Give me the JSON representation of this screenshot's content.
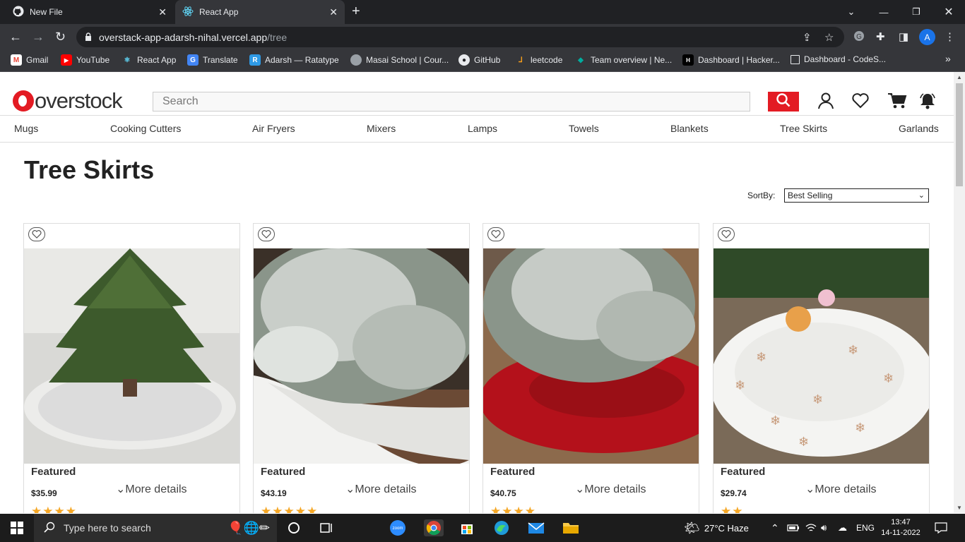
{
  "browser": {
    "tabs": [
      {
        "title": "New File",
        "close": "✕"
      },
      {
        "title": "React App",
        "close": "✕"
      }
    ],
    "new_tab": "+",
    "url_host": "overstack-app-adarsh-nihal.vercel.app",
    "url_path": "/tree",
    "profile_initial": "A",
    "bookmarks": [
      {
        "label": "Gmail"
      },
      {
        "label": "YouTube"
      },
      {
        "label": "React App"
      },
      {
        "label": "Translate"
      },
      {
        "label": "Adarsh — Ratatype"
      },
      {
        "label": "Masai School | Cour..."
      },
      {
        "label": "GitHub"
      },
      {
        "label": "leetcode"
      },
      {
        "label": "Team overview | Ne..."
      },
      {
        "label": "Dashboard | Hacker..."
      },
      {
        "label": "Dashboard - CodeS..."
      }
    ],
    "more_bookmarks": "»"
  },
  "site": {
    "logo_text": "overstock",
    "search_placeholder": "Search",
    "categories": [
      "Mugs",
      "Cooking Cutters",
      "Air Fryers",
      "Mixers",
      "Lamps",
      "Towels",
      "Blankets",
      "Tree Skirts",
      "Garlands"
    ],
    "page_title": "Tree Skirts",
    "sort_label": "SortBy:",
    "sort_value": "Best Selling",
    "products": [
      {
        "badge": "Featured",
        "price": "$35.99",
        "more": "More details",
        "stars": "★★★★",
        "rating": 4
      },
      {
        "badge": "Featured",
        "price": "$43.19",
        "more": "More details",
        "stars": "★★★★★",
        "rating": 5
      },
      {
        "badge": "Featured",
        "price": "$40.75",
        "more": "More details",
        "stars": "★★★★",
        "rating": 4
      },
      {
        "badge": "Featured",
        "price": "$29.74",
        "more": "More details",
        "stars": "★★",
        "rating": 2
      }
    ]
  },
  "taskbar": {
    "search_placeholder": "Type here to search",
    "weather": "27°C  Haze",
    "language": "ENG",
    "time": "13:47",
    "date": "14-11-2022",
    "zoom_label": "zoom"
  }
}
